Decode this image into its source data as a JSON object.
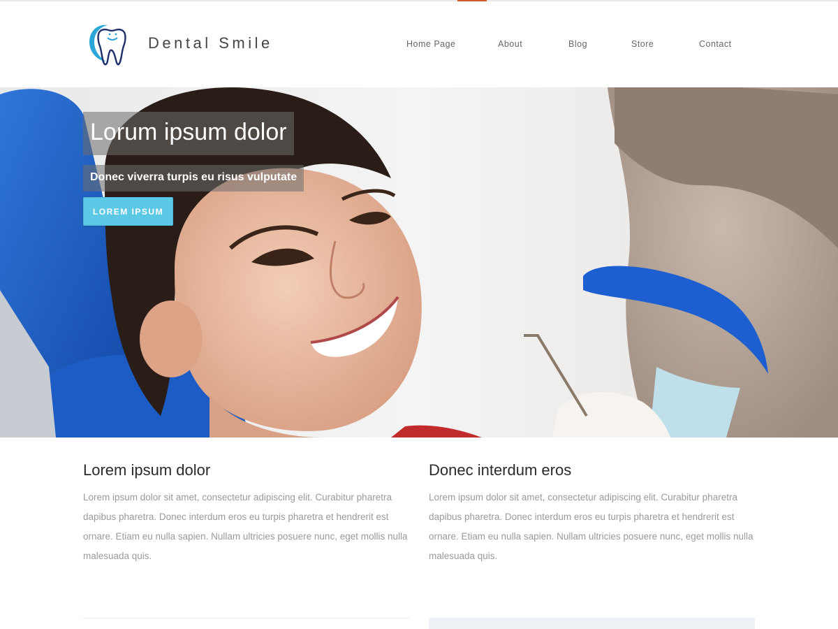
{
  "site": {
    "brand": "Dental Smile"
  },
  "nav": {
    "items": [
      "Home Page",
      "About",
      "Blog",
      "Store",
      "Contact"
    ]
  },
  "hero": {
    "title": "Lorum ipsum dolor",
    "subtitle": "Donec viverra turpis eu risus vulputate",
    "button_label": "LOREM IPSUM"
  },
  "columns": [
    {
      "heading": "Lorem ipsum dolor",
      "body": "Lorem ipsum dolor sit amet, consectetur adipiscing elit. Curabitur pharetra dapibus pharetra. Donec interdum eros eu turpis pharetra et hendrerit est ornare. Etiam eu nulla sapien. Nullam ultricies posuere nunc, eget mollis nulla malesuada quis."
    },
    {
      "heading": "Donec interdum eros",
      "body": "Lorem ipsum dolor sit amet, consectetur adipiscing elit. Curabitur pharetra dapibus pharetra. Donec interdum eros eu turpis pharetra et hendrerit est ornare. Etiam eu nulla sapien. Nullam ultricies posuere nunc, eget mollis nulla malesuada quis."
    }
  ],
  "colors": {
    "accent_button": "#5bc8e6",
    "top_accent": "#d35a2a",
    "logo_blue": "#2aa7d8",
    "logo_navy": "#1f2f6b"
  },
  "icons": {
    "logo": "tooth-logo-icon"
  }
}
